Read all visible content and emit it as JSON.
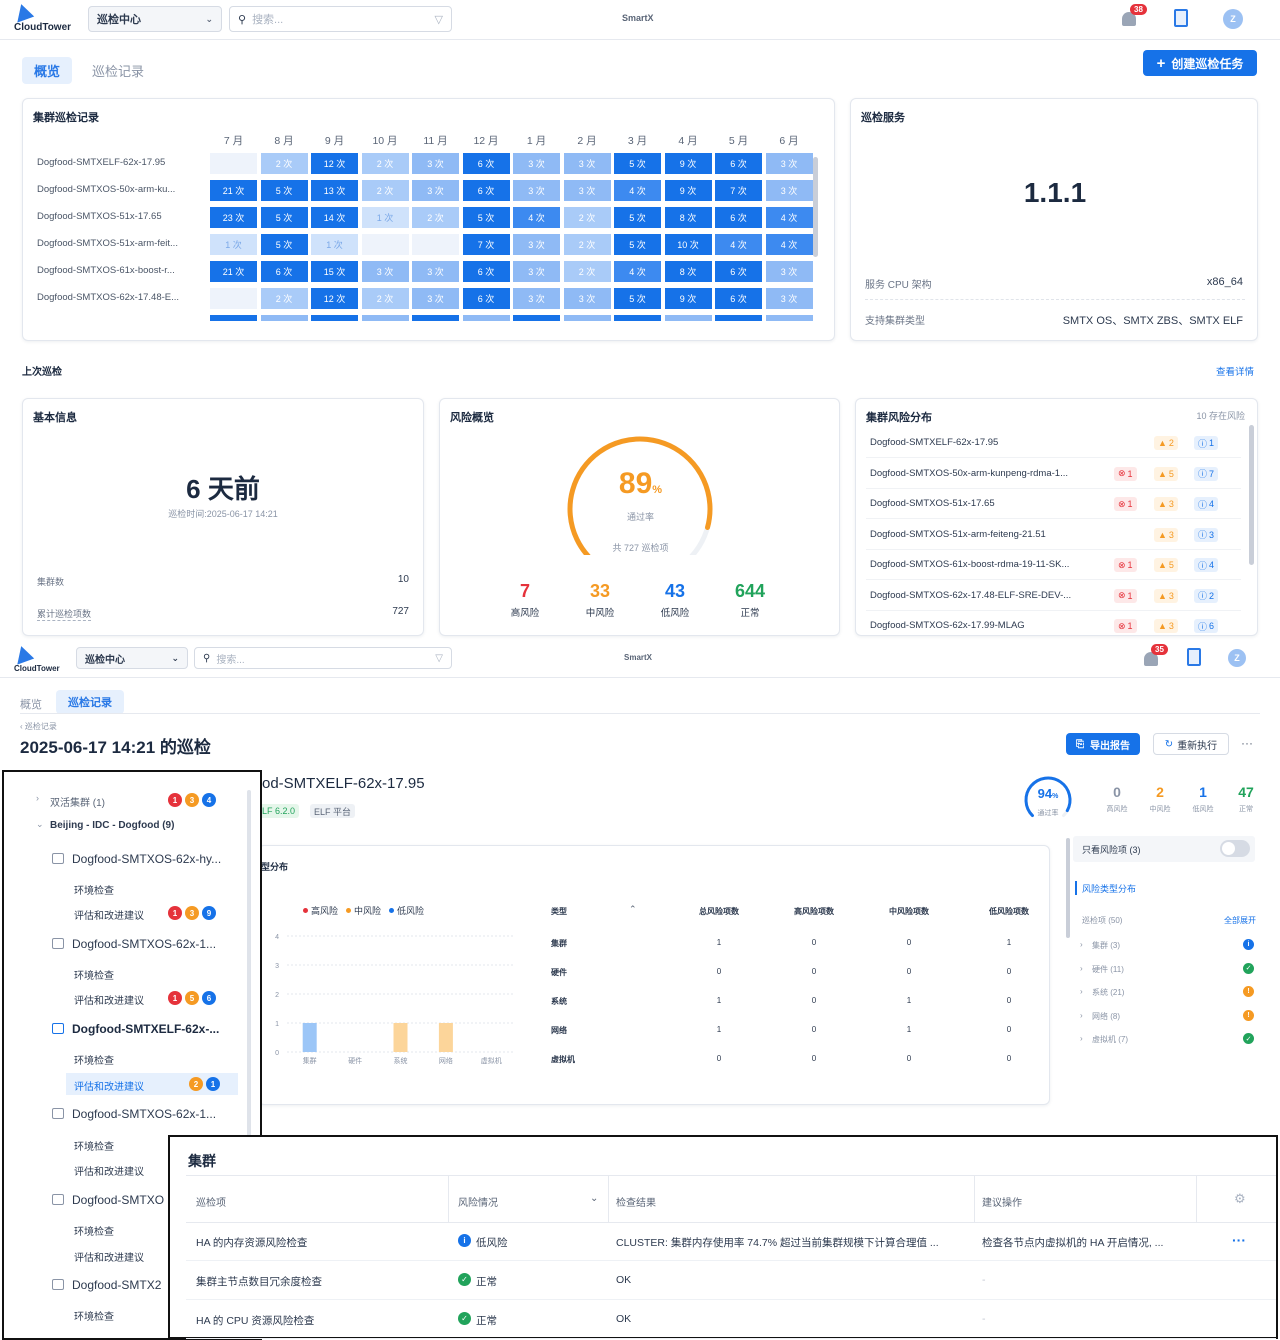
{
  "app": {
    "logo_text": "CloudTower",
    "brand": "SmartX",
    "module": "巡检中心",
    "search_placeholder": "搜索...",
    "notif_count_1": "38",
    "notif_count_2": "35",
    "avatar": "Z"
  },
  "overview": {
    "tabs": [
      "概览",
      "巡检记录"
    ],
    "create_button": "创建巡检任务",
    "heatmap": {
      "title": "集群巡检记录",
      "months": [
        "7 月",
        "8 月",
        "9 月",
        "10 月",
        "11 月",
        "12 月",
        "1 月",
        "2 月",
        "3 月",
        "4 月",
        "5 月",
        "6 月"
      ],
      "rows": [
        {
          "name": "Dogfood-SMTXELF-62x-17.95",
          "counts": [
            null,
            "2 次",
            "12 次",
            "2 次",
            "3 次",
            "6 次",
            "3 次",
            "3 次",
            "5 次",
            "9 次",
            "6 次",
            "3 次"
          ]
        },
        {
          "name": "Dogfood-SMTXOS-50x-arm-ku...",
          "counts": [
            "21 次",
            "5 次",
            "13 次",
            "2 次",
            "3 次",
            "6 次",
            "3 次",
            "3 次",
            "4 次",
            "9 次",
            "7 次",
            "3 次"
          ]
        },
        {
          "name": "Dogfood-SMTXOS-51x-17.65",
          "counts": [
            "23 次",
            "5 次",
            "14 次",
            "1 次",
            "2 次",
            "5 次",
            "4 次",
            "2 次",
            "5 次",
            "8 次",
            "6 次",
            "4 次"
          ]
        },
        {
          "name": "Dogfood-SMTXOS-51x-arm-feit...",
          "counts": [
            "1 次",
            "5 次",
            "1 次",
            null,
            null,
            "7 次",
            "3 次",
            "2 次",
            "5 次",
            "10 次",
            "4 次",
            "4 次"
          ]
        },
        {
          "name": "Dogfood-SMTXOS-61x-boost-r...",
          "counts": [
            "21 次",
            "6 次",
            "15 次",
            "3 次",
            "3 次",
            "6 次",
            "3 次",
            "2 次",
            "4 次",
            "8 次",
            "6 次",
            "3 次"
          ]
        },
        {
          "name": "Dogfood-SMTXOS-62x-17.48-E...",
          "counts": [
            null,
            "2 次",
            "12 次",
            "2 次",
            "3 次",
            "6 次",
            "3 次",
            "3 次",
            "5 次",
            "9 次",
            "6 次",
            "3 次"
          ]
        }
      ]
    },
    "service": {
      "title": "巡检服务",
      "version": "1.1.1",
      "cpu_label": "服务 CPU 架构",
      "cpu_value": "x86_64",
      "types_label": "支持集群类型",
      "types_value": "SMTX OS、SMTX ZBS、SMTX ELF"
    },
    "last": {
      "section": "上次巡检",
      "detail_link": "查看详情"
    },
    "basic": {
      "title": "基本信息",
      "ago": "6 天前",
      "time": "巡检时间:2025-06-17 14:21",
      "clusters_label": "集群数",
      "clusters_value": "10",
      "items_label": "累计巡检项数",
      "items_value": "727"
    },
    "risk": {
      "title": "风险概览",
      "rate": "89",
      "rate_unit": "%",
      "rate_label": "通过率",
      "total": "共 727 巡检项",
      "pass_fraction": 0.89,
      "stats": [
        {
          "value": "7",
          "label": "高风险",
          "color": "#e5323b"
        },
        {
          "value": "33",
          "label": "中风险",
          "color": "#f59a23"
        },
        {
          "value": "43",
          "label": "低风险",
          "color": "#1672e8"
        },
        {
          "value": "644",
          "label": "正常",
          "color": "#21a35b"
        }
      ]
    },
    "dist": {
      "title": "集群风险分布",
      "subtitle": "10 存在风险",
      "rows": [
        {
          "name": "Dogfood-SMTXELF-62x-17.95",
          "high": null,
          "mid": "2",
          "low": "1"
        },
        {
          "name": "Dogfood-SMTXOS-50x-arm-kunpeng-rdma-1...",
          "high": "1",
          "mid": "5",
          "low": "7"
        },
        {
          "name": "Dogfood-SMTXOS-51x-17.65",
          "high": "1",
          "mid": "3",
          "low": "4"
        },
        {
          "name": "Dogfood-SMTXOS-51x-arm-feiteng-21.51",
          "high": null,
          "mid": "3",
          "low": "3"
        },
        {
          "name": "Dogfood-SMTXOS-61x-boost-rdma-19-11-SK...",
          "high": "1",
          "mid": "5",
          "low": "4"
        },
        {
          "name": "Dogfood-SMTXOS-62x-17.48-ELF-SRE-DEV-...",
          "high": "1",
          "mid": "3",
          "low": "2"
        },
        {
          "name": "Dogfood-SMTXOS-62x-17.99-MLAG",
          "high": "1",
          "mid": "3",
          "low": "6"
        }
      ]
    }
  },
  "record": {
    "tabs": [
      "概览",
      "巡检记录"
    ],
    "breadcrumb": "巡检记录",
    "title": "2025-06-17 14:21 的巡检",
    "export": "导出报告",
    "rerun": "重新执行",
    "more": "···",
    "cluster_name": "od-SMTXELF-62x-17.95",
    "tag1": "LF 6.2.0",
    "tag2": "ELF 平台",
    "pass_rate": "94",
    "pass_unit": "%",
    "pass_label": "通过率",
    "pass_fraction": 0.94,
    "counts": [
      {
        "value": "0",
        "label": "高风险",
        "color": "#8a94a6"
      },
      {
        "value": "2",
        "label": "中风险",
        "color": "#f59a23"
      },
      {
        "value": "1",
        "label": "低风险",
        "color": "#1672e8"
      },
      {
        "value": "47",
        "label": "正常",
        "color": "#21a35b"
      }
    ],
    "chart_title": "型分布",
    "legend": [
      "高风险",
      "中风险",
      "低风险"
    ],
    "table_headers": [
      "类型",
      "总风险项数",
      "高风险项数",
      "中风险项数",
      "低风险项数"
    ],
    "table_rows": [
      {
        "type": "集群",
        "total": "1",
        "high": "0",
        "mid": "0",
        "low": "1"
      },
      {
        "type": "硬件",
        "total": "0",
        "high": "0",
        "mid": "0",
        "low": "0"
      },
      {
        "type": "系统",
        "total": "1",
        "high": "0",
        "mid": "1",
        "low": "0"
      },
      {
        "type": "网络",
        "total": "1",
        "high": "0",
        "mid": "1",
        "low": "0"
      },
      {
        "type": "虚拟机",
        "total": "0",
        "high": "0",
        "mid": "0",
        "low": "0"
      }
    ],
    "right": {
      "only_risk": "只看风险项 (3)",
      "dist_link": "风险类型分布",
      "items_label": "巡检项 (50)",
      "expand_all": "全部展开",
      "cats": [
        {
          "label": "集群 (3)",
          "status": "info"
        },
        {
          "label": "硬件 (11)",
          "status": "ok"
        },
        {
          "label": "系统 (21)",
          "status": "warn"
        },
        {
          "label": "网络 (8)",
          "status": "warn"
        },
        {
          "label": "虚拟机 (7)",
          "status": "ok"
        }
      ]
    }
  },
  "chart_data": {
    "type": "bar",
    "categories": [
      "集群",
      "硬件",
      "系统",
      "网络",
      "虚拟机"
    ],
    "series": [
      {
        "name": "高风险",
        "values": [
          0,
          0,
          0,
          0,
          0
        ]
      },
      {
        "name": "中风险",
        "values": [
          0,
          0,
          1,
          1,
          0
        ]
      },
      {
        "name": "低风险",
        "values": [
          1,
          0,
          0,
          0,
          0
        ]
      }
    ],
    "ylim": [
      0,
      4
    ],
    "yticks": [
      "0",
      "1",
      "2",
      "3",
      "4"
    ],
    "legend": "top"
  },
  "tree": {
    "items": [
      {
        "kind": "group",
        "label": "双活集群 (1)",
        "badges": [
          "1",
          "3",
          "4"
        ]
      },
      {
        "kind": "group",
        "label": "Beijing - IDC - Dogfood (9)",
        "badges": []
      },
      {
        "kind": "cluster",
        "label": "Dogfood-SMTXOS-62x-hy..."
      },
      {
        "kind": "leaf",
        "label": "环境检查"
      },
      {
        "kind": "leaf",
        "label": "评估和改进建议",
        "badges": [
          "1",
          "3",
          "9"
        ]
      },
      {
        "kind": "cluster",
        "label": "Dogfood-SMTXOS-62x-1..."
      },
      {
        "kind": "leaf",
        "label": "环境检查"
      },
      {
        "kind": "leaf",
        "label": "评估和改进建议",
        "badges": [
          "1",
          "5",
          "6"
        ]
      },
      {
        "kind": "cluster",
        "label": "Dogfood-SMTXELF-62x-...",
        "active": true
      },
      {
        "kind": "leaf",
        "label": "环境检查"
      },
      {
        "kind": "leaf",
        "label": "评估和改进建议",
        "badges": [
          "2",
          "1"
        ],
        "active": true
      },
      {
        "kind": "cluster",
        "label": "Dogfood-SMTXOS-62x-1..."
      },
      {
        "kind": "leaf",
        "label": "环境检查"
      },
      {
        "kind": "leaf",
        "label": "评估和改进建议"
      },
      {
        "kind": "cluster",
        "label": "Dogfood-SMTXO"
      },
      {
        "kind": "leaf",
        "label": "环境检查"
      },
      {
        "kind": "leaf",
        "label": "评估和改进建议"
      },
      {
        "kind": "cluster",
        "label": "Dogfood-SMTX2"
      },
      {
        "kind": "leaf",
        "label": "环境检查"
      }
    ]
  },
  "popup": {
    "title": "集群",
    "headers": [
      "巡检项",
      "风险情况",
      "检查结果",
      "建议操作"
    ],
    "rows": [
      {
        "item": "HA 的内存资源风险检查",
        "risk": "低风险",
        "risk_kind": "low",
        "result": "CLUSTER: 集群内存使用率 74.7% 超过当前集群规模下计算合理值 ...",
        "advice": "检查各节点内虚拟机的 HA 开启情况, ...",
        "more": "···"
      },
      {
        "item": "集群主节点数目冗余度检查",
        "risk": "正常",
        "risk_kind": "ok",
        "result": "OK",
        "advice": "-"
      },
      {
        "item": "HA 的 CPU 资源风险检查",
        "risk": "正常",
        "risk_kind": "ok",
        "result": "OK",
        "advice": "-"
      }
    ]
  },
  "colors": {
    "primary": "#1672e8",
    "high": "#e5323b",
    "mid": "#f59a23",
    "low": "#1672e8",
    "ok": "#21a35b"
  }
}
